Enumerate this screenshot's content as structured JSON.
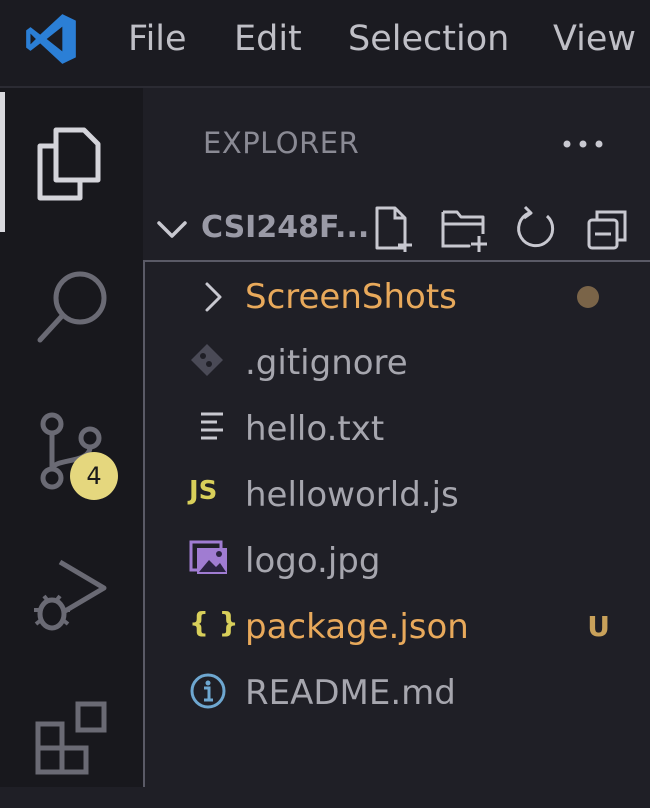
{
  "menu": {
    "file": "File",
    "edit": "Edit",
    "selection": "Selection",
    "view": "View"
  },
  "activity_bar": {
    "items": [
      {
        "name": "explorer",
        "icon": "files-icon",
        "active": true
      },
      {
        "name": "search",
        "icon": "search-icon"
      },
      {
        "name": "source-control",
        "icon": "source-control-icon",
        "badge": "4"
      },
      {
        "name": "run-and-debug",
        "icon": "run-debug-icon"
      },
      {
        "name": "extensions",
        "icon": "extensions-icon"
      }
    ],
    "source_control_badge": "4"
  },
  "sidebar": {
    "title": "EXPLORER",
    "folder_name": "CSI248F...",
    "actions": [
      "new-file-icon",
      "new-folder-icon",
      "refresh-icon",
      "collapse-all-icon"
    ],
    "items": [
      {
        "label": "ScreenShots",
        "type": "folder",
        "status": "",
        "color": "#e8a95b"
      },
      {
        "label": ".gitignore",
        "type": "file",
        "status": "",
        "color": "#a6a6ae"
      },
      {
        "label": "hello.txt",
        "type": "file",
        "status": "",
        "color": "#a6a6ae"
      },
      {
        "label": "helloworld.js",
        "type": "file",
        "icon_text": "JS",
        "status": "",
        "color": "#a6a6ae"
      },
      {
        "label": "logo.jpg",
        "type": "file",
        "status": "",
        "color": "#a6a6ae"
      },
      {
        "label": "package.json",
        "type": "file",
        "icon_text": "{ }",
        "status": "U",
        "color": "#e8a95b"
      },
      {
        "label": "README.md",
        "type": "file",
        "status": "",
        "color": "#a6a6ae"
      }
    ]
  },
  "colors": {
    "accent_modified": "#e8a95b",
    "status_u": "#c9a15a",
    "vscode_blue": "#2b7fd6",
    "js_yellow": "#d8cf5a",
    "json_yellow": "#d8cf5a",
    "image_purple": "#a07cd2",
    "info_blue": "#6ea7d0",
    "badge_bg": "#e5d77e"
  }
}
